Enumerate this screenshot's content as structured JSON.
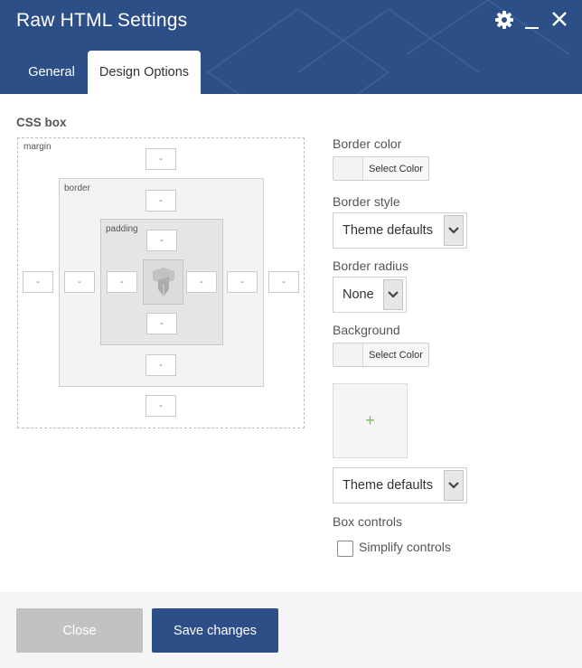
{
  "window": {
    "title": "Raw HTML Settings"
  },
  "header_icons": {
    "settings": "gear-icon",
    "minimize": "minimize-icon",
    "close": "close-icon"
  },
  "tabs": [
    {
      "label": "General",
      "active": false
    },
    {
      "label": "Design Options",
      "active": true
    }
  ],
  "css_box": {
    "title": "CSS box",
    "margin_label": "margin",
    "border_label": "border",
    "padding_label": "padding",
    "margin": {
      "top": "-",
      "right": "-",
      "bottom": "-",
      "left": "-"
    },
    "border": {
      "top": "-",
      "right": "-",
      "bottom": "-",
      "left": "-"
    },
    "padding": {
      "top": "-",
      "right": "-",
      "bottom": "-",
      "left": "-"
    }
  },
  "border_color": {
    "label": "Border color",
    "button": "Select Color"
  },
  "border_style": {
    "label": "Border style",
    "value": "Theme defaults"
  },
  "border_radius": {
    "label": "Border radius",
    "value": "None"
  },
  "background": {
    "label": "Background",
    "button": "Select Color",
    "add_image": "+",
    "style_value": "Theme defaults"
  },
  "box_controls": {
    "label": "Box controls",
    "checkbox_label": "Simplify controls",
    "checked": false
  },
  "footer": {
    "close_label": "Close",
    "save_label": "Save changes"
  },
  "colors": {
    "header": "#2d4f87",
    "save_button": "#2d4f87",
    "close_button": "#c2c2c2",
    "plus": "#7ac043"
  }
}
